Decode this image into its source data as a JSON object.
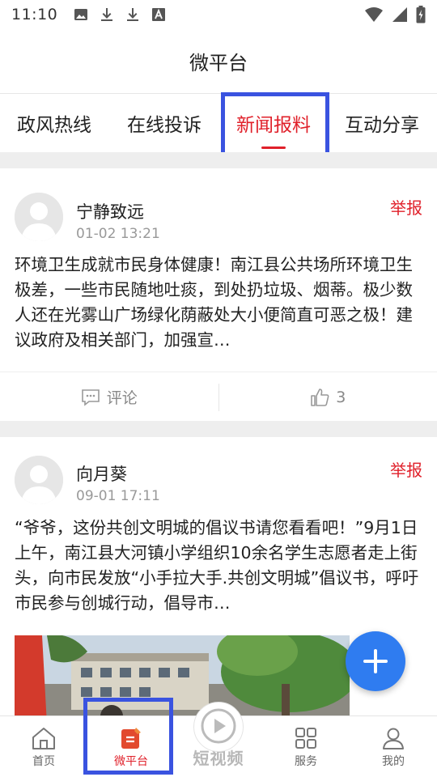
{
  "status_bar": {
    "time": "11:10",
    "icons_left": [
      "image-icon",
      "download-icon",
      "download-icon",
      "font-icon"
    ],
    "icons_right": [
      "wifi-icon",
      "signal-icon",
      "battery-charging-icon"
    ]
  },
  "header": {
    "title": "微平台"
  },
  "tabs": [
    {
      "label": "政风热线",
      "active": false
    },
    {
      "label": "在线投诉",
      "active": false
    },
    {
      "label": "新闻报料",
      "active": true
    },
    {
      "label": "互动分享",
      "active": false
    }
  ],
  "posts": [
    {
      "author": "宁静致远",
      "time": "01-02 13:21",
      "report_label": "举报",
      "body": "环境卫生成就市民身体健康！南江县公共场所环境卫生极差，一些市民随地吐痰，到处扔垃圾、烟蒂。极少数人还在光雾山广场绿化荫蔽处大小便简直可恶之极！建议政府及相关部门，加强宣…",
      "comment_label": "评论",
      "like_count": "3"
    },
    {
      "author": "向月葵",
      "time": "09-01 17:11",
      "report_label": "举报",
      "body": "“爷爷，这份共创文明城的倡议书请您看看吧！”9月1日上午，南江县大河镇小学组织10余名学生志愿者走上街头，向市民发放“小手拉大手.共创文明城”倡议书，呼吁市民参与创城行动，倡导市…"
    }
  ],
  "bottom_nav": [
    {
      "label": "首页",
      "icon": "home-icon",
      "active": false
    },
    {
      "label": "微平台",
      "icon": "document-icon",
      "active": true
    },
    {
      "label": "短视频",
      "icon": "play-icon",
      "active": false
    },
    {
      "label": "服务",
      "icon": "grid-icon",
      "active": false
    },
    {
      "label": "我的",
      "icon": "user-icon",
      "active": false
    }
  ],
  "colors": {
    "accent": "#e0202a",
    "fab": "#2f7cf0",
    "highlight": "#3a53e0"
  }
}
